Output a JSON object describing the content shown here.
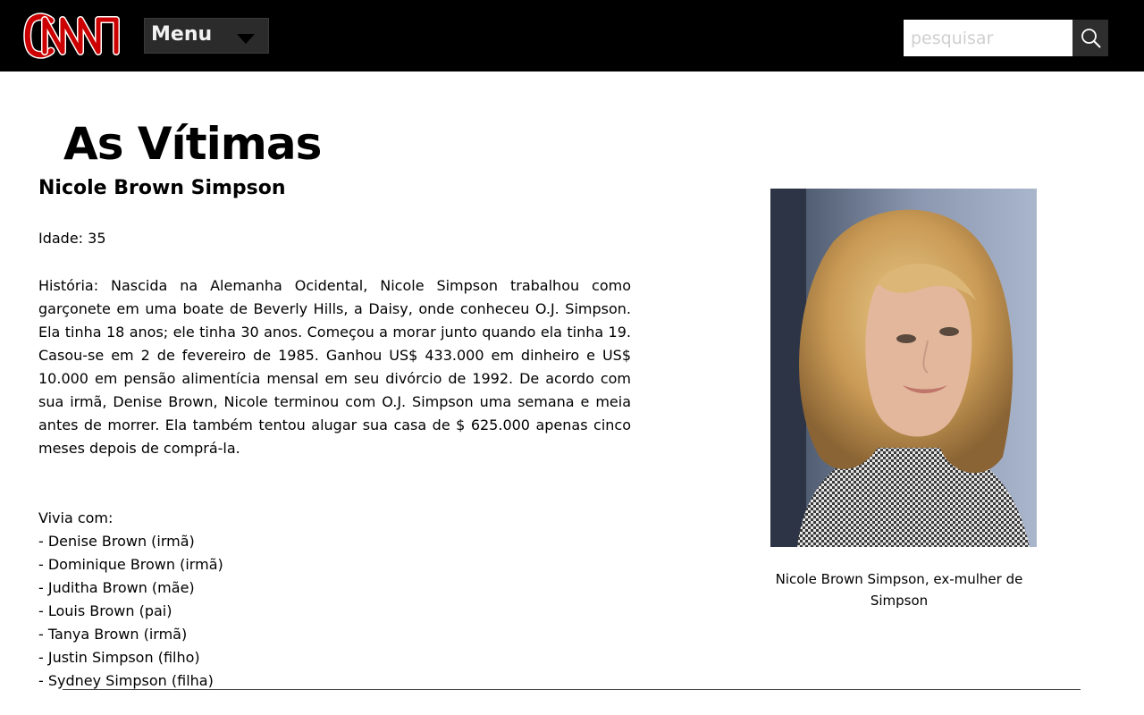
{
  "header": {
    "logo_text": "CNN",
    "menu_label": "Menu",
    "search": {
      "placeholder": "pesquisar",
      "value": ""
    },
    "brand_color": "#cc0000"
  },
  "main": {
    "title": "As Vítimas",
    "victim": {
      "name": "Nicole Brown Simpson",
      "age": "Idade: 35",
      "history": "História: Nascida na Alemanha Ocidental, Nicole Simpson trabalhou como garçonete em uma boate de Beverly Hills, a Daisy, onde conheceu O.J. Simpson. Ela tinha 18 anos; ele tinha 30 anos. Começou a morar junto quando ela tinha 19. Casou-se em 2 de fevereiro de 1985. Ganhou US$ 433.000 em dinheiro e US$ 10.000 em pensão alimentícia mensal em seu divórcio de 1992. De acordo com sua irmã, Denise Brown, Nicole terminou com O.J. Simpson uma semana e meia antes de morrer. Ela também tentou alugar sua casa de $ 625.000 apenas cinco meses depois de comprá-la.",
      "lived_with_label": "Vivia com:",
      "lived_with": [
        "- Denise Brown (irmã)",
        "- Dominique Brown (irmã)",
        "- Juditha Brown (mãe)",
        "- Louis Brown (pai)",
        "- Tanya Brown (irmã)",
        "- Justin Simpson (filho)",
        "- Sydney Simpson (filha)"
      ],
      "photo_caption": "Nicole Brown Simpson, ex-mulher de Simpson"
    }
  }
}
